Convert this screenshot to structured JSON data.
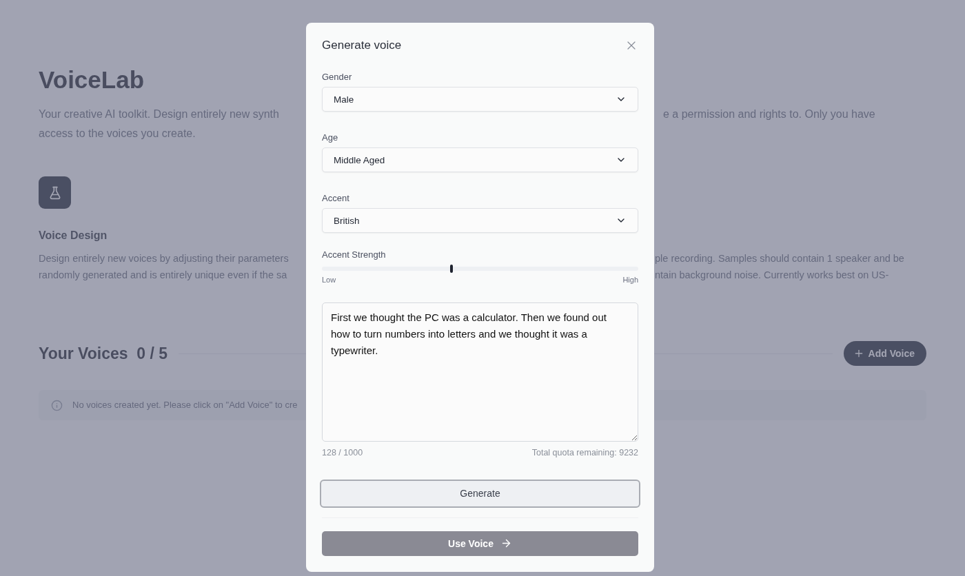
{
  "page": {
    "title": "VoiceLab",
    "intro_left": [
      "Your creative AI toolkit. Design entirely new synth",
      "access to the voices you create."
    ],
    "intro_right": [
      "e a permission and rights to. Only you have"
    ],
    "feature": {
      "title": "Voice Design",
      "text_left": [
        "Design entirely new voices by adjusting their parameters",
        "randomly generated and is entirely unique even if the sa"
      ],
      "text_right": [
        "ple recording. Samples should contain 1 speaker and be",
        "ntain background noise. Currently works best on US-"
      ]
    },
    "voices_heading": "Your Voices",
    "voices_count": "0 / 5",
    "add_button": "Add Voice",
    "notice": "No voices created yet. Please click on \"Add Voice\" to cre"
  },
  "dialog": {
    "title": "Generate voice",
    "selects": [
      {
        "label": "Gender",
        "value": "Male"
      },
      {
        "label": "Age",
        "value": "Middle Aged"
      },
      {
        "label": "Accent",
        "value": "British"
      }
    ],
    "slider": {
      "label": "Accent Strength",
      "level": 0.41,
      "min_label": "Low",
      "max_label": "High"
    },
    "text": "First we thought the PC was a calculator. Then we found out how to turn numbers into letters and we thought it was a typewriter.",
    "char_count": "128 / 1000",
    "quota": "Total quota remaining: 9232",
    "generate_button": "Generate",
    "use_button": "Use Voice"
  }
}
